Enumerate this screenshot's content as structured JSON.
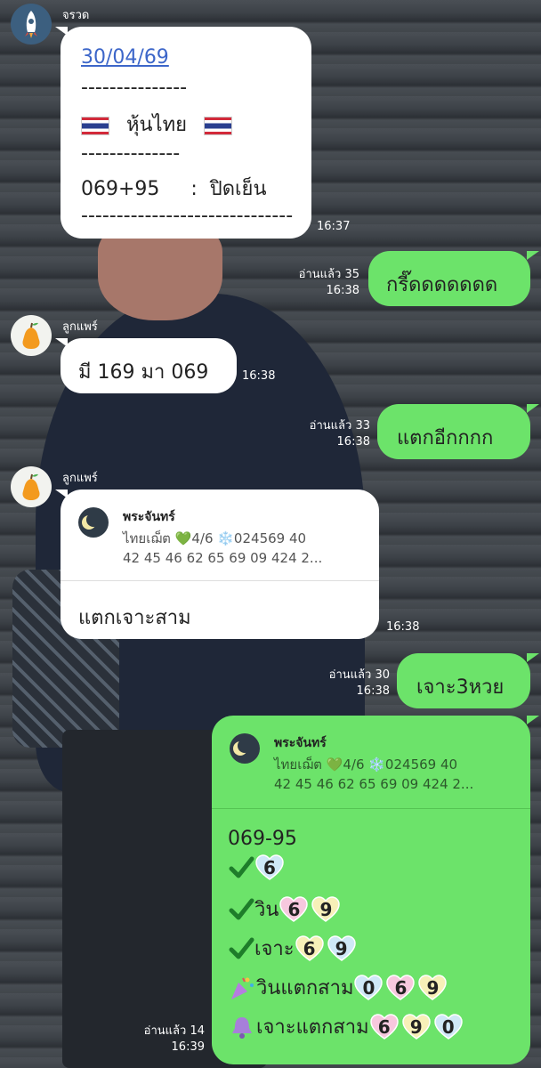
{
  "chat": {
    "messages": [
      {
        "sender": "จรวด",
        "date_link": "30/04/69",
        "dashes1": "---------------",
        "stock_label": "หุ้นไทย",
        "dashes2": "--------------",
        "result": "069+95     :  ปิดเย็น",
        "dashes3": "------------------------------",
        "time": "16:37"
      },
      {
        "text": "กรี๊ดดดดดดด",
        "read": "อ่านแล้ว 35",
        "time": "16:38"
      },
      {
        "sender": "ลูกแพร์",
        "text": "มี 169 มา 069",
        "time": "16:38"
      },
      {
        "text": "แตกอีกกกก",
        "read": "อ่านแล้ว 33",
        "time": "16:38"
      },
      {
        "sender": "ลูกแพร์",
        "quote": {
          "name": "พระจันทร์",
          "line1": "ไทยเฌ็ต 💚4/6 ❄️024569 40",
          "line2": "42 45 46 62 65 69 09 424 2..."
        },
        "text": "แตกเจาะสาม",
        "time": "16:38"
      },
      {
        "text": "เจาะ3หวย",
        "read": "อ่านแล้ว 30",
        "time": "16:38"
      },
      {
        "quote": {
          "name": "พระจันทร์",
          "line1": "ไทยเฌ็ต 💚4/6 ❄️024569 40",
          "line2": "42 45 46 62 65 69 09 424 2..."
        },
        "header": "069-95",
        "rows": [
          {
            "label": "",
            "digits": [
              "6"
            ]
          },
          {
            "label": "วิน",
            "digits": [
              "6",
              "9"
            ]
          },
          {
            "label": "เจาะ",
            "digits": [
              "6",
              "9"
            ]
          },
          {
            "label": "วินแตกสาม",
            "digits": [
              "0",
              "6",
              "9"
            ]
          },
          {
            "label": "เจาะแตกสาม",
            "digits": [
              "6",
              "9",
              "0"
            ]
          }
        ],
        "read": "อ่านแล้ว 14",
        "time": "16:39"
      }
    ]
  },
  "icons": {
    "avatar1": "rocket-icon",
    "avatar2": "pear-icon",
    "quote_avatar": "moon-icon",
    "check": "check-icon",
    "confetti": "party-popper-icon",
    "bell": "bell-icon"
  },
  "colors": {
    "bubble_green": "#6ce36a",
    "bubble_white": "#ffffff",
    "link": "#3c66c9"
  }
}
